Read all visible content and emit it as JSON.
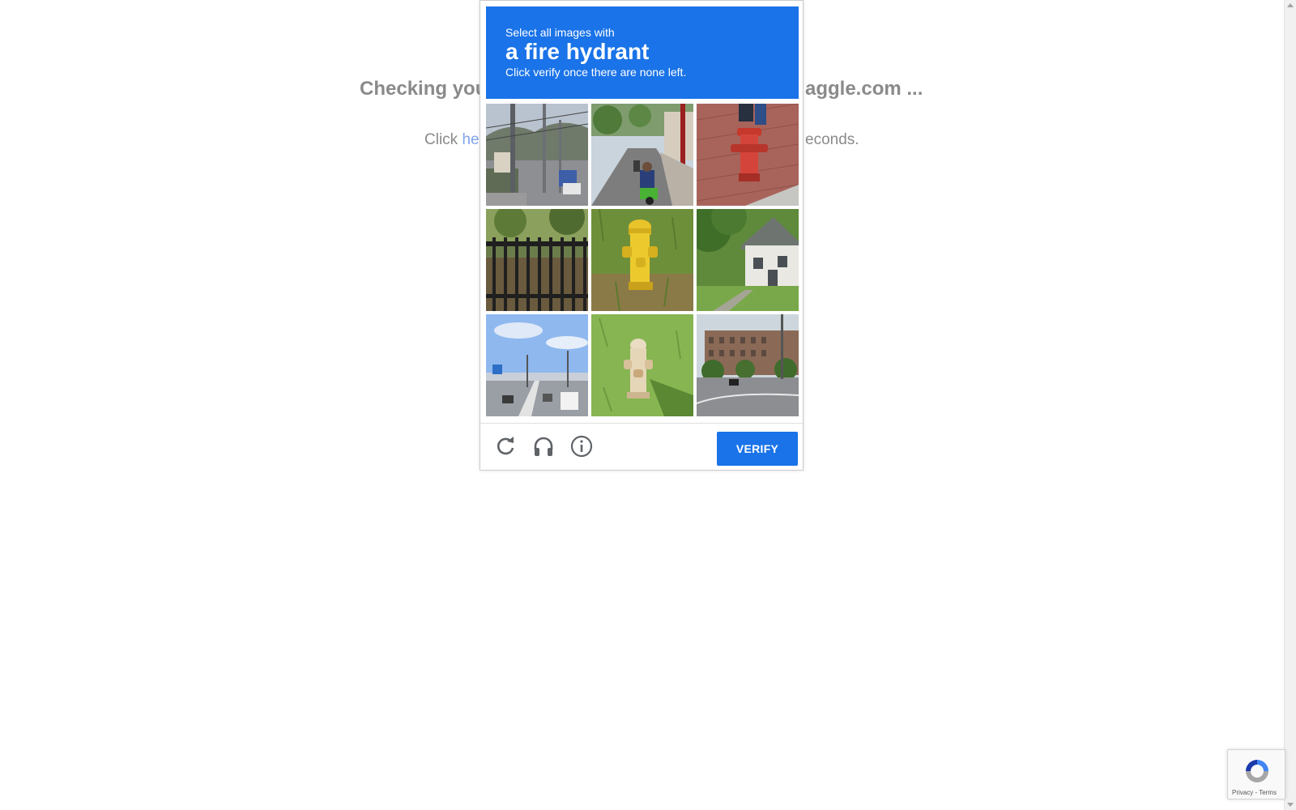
{
  "background": {
    "heading_left": "Checking you",
    "heading_right": "aggle.com ...",
    "sub_left_text": "Click ",
    "sub_left_link": "he",
    "sub_right": "econds."
  },
  "captcha": {
    "header": {
      "line1": "Select all images with",
      "target": "a fire hydrant",
      "line3": "Click verify once there are none left."
    },
    "tiles": [
      {
        "label": "street with utility poles and trucks"
      },
      {
        "label": "road with scooter rider"
      },
      {
        "label": "red fire hydrant on brick sidewalk"
      },
      {
        "label": "black iron fence"
      },
      {
        "label": "yellow fire hydrant in grass"
      },
      {
        "label": "white house with lawn"
      },
      {
        "label": "highway with overpass"
      },
      {
        "label": "white fire hydrant on grass"
      },
      {
        "label": "road near brick building"
      }
    ],
    "footer": {
      "reload_icon": "reload-icon",
      "audio_icon": "headphones-icon",
      "info_icon": "info-icon",
      "verify_label": "VERIFY"
    },
    "colors": {
      "accent": "#1a73e8"
    }
  },
  "badge": {
    "links": "Privacy - Terms"
  }
}
